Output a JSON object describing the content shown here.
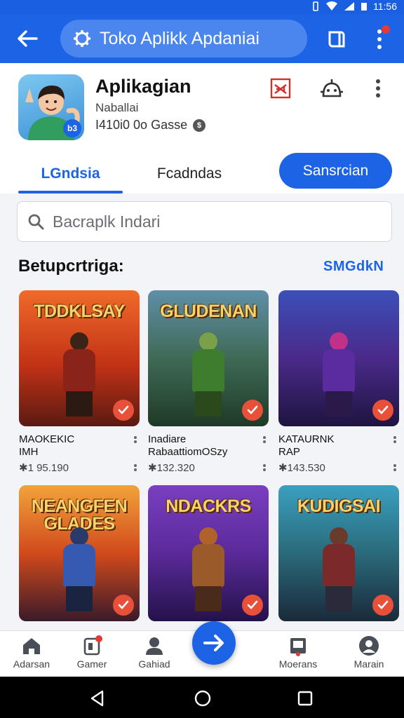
{
  "status_bar": {
    "time": "11:56"
  },
  "app_bar": {
    "search_text": "Toko Aplikk Apdaniai"
  },
  "app": {
    "name": "Aplikagian",
    "developer": "Naballai",
    "stats": "I410i0 0o Gasse"
  },
  "tabs": [
    {
      "label": "LGndsia",
      "active": true
    },
    {
      "label": "Fcadndas",
      "active": false
    }
  ],
  "subscribe_label": "Sansrcian",
  "search": {
    "placeholder": "Bacraplk Indari"
  },
  "section": {
    "title": "Betupcrtriga:",
    "link": "SMGdkN"
  },
  "games": [
    {
      "art_title": "TDDKLSAY",
      "name": "MAOKEKIC\nIMH",
      "rating": "✱1 95.190",
      "palette": "red"
    },
    {
      "art_title": "GLUDENAN",
      "name": "Inadiare\nRabaattiomOSzy",
      "rating": "✱132.320",
      "palette": "green"
    },
    {
      "art_title": "",
      "name": "KATAURNK\nRAP",
      "rating": "✱143.530",
      "palette": "purple"
    },
    {
      "art_title": "NEANGFEN\nGLADES",
      "name": "",
      "rating": "",
      "palette": "orange"
    },
    {
      "art_title": "NDACKRS",
      "name": "",
      "rating": "",
      "palette": "violet"
    },
    {
      "art_title": "KUDIGSAI",
      "name": "",
      "rating": "",
      "palette": "teal"
    }
  ],
  "bottom_nav": [
    {
      "label": "Adarsan",
      "icon": "home-icon"
    },
    {
      "label": "Gamer",
      "icon": "games-icon"
    },
    {
      "label": "Gahiad",
      "icon": "profile-icon"
    },
    {
      "label": "Moerans",
      "icon": "store-icon"
    },
    {
      "label": "Marain",
      "icon": "account-icon"
    }
  ],
  "colors": {
    "primary": "#1d63e6",
    "accent": "#e8503a"
  }
}
